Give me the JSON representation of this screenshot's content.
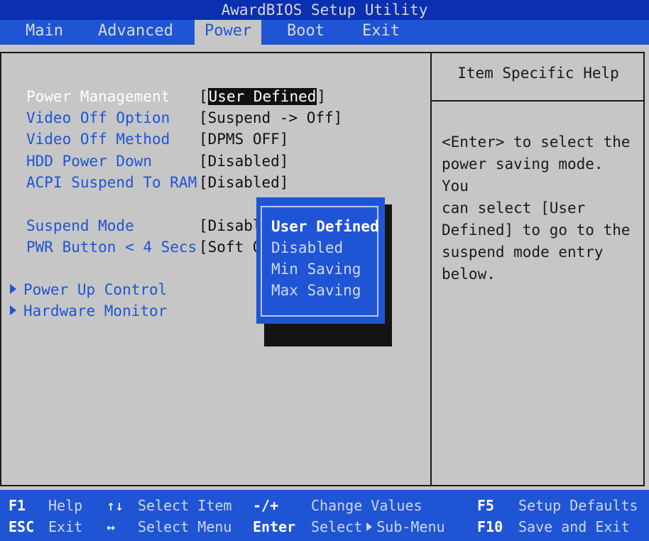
{
  "window": {
    "title": "AwardBIOS Setup Utility"
  },
  "menu": {
    "tabs": [
      {
        "label": "Main"
      },
      {
        "label": "Advanced"
      },
      {
        "label": "Power"
      },
      {
        "label": "Boot"
      },
      {
        "label": "Exit"
      }
    ],
    "active": "Power"
  },
  "options": [
    {
      "label": "Power Management",
      "value": "[",
      "value_highlight": "User Defined",
      "value_end": "]"
    },
    {
      "label": "Video Off Option",
      "value": "[Suspend -> Off]"
    },
    {
      "label": "Video Off Method",
      "value": "[DPMS OFF]"
    },
    {
      "label": "HDD Power Down",
      "value": "[Disabled]"
    },
    {
      "label": "ACPI Suspend To RAM",
      "value": "[Disabled]"
    },
    {
      "label": "Suspend Mode",
      "value": "[Disabl"
    },
    {
      "label": "PWR Button < 4 Secs",
      "value": "[Soft O"
    }
  ],
  "submenus": [
    {
      "label": "Power Up Control",
      "icon": "triangle-right-icon"
    },
    {
      "label": "Hardware Monitor",
      "icon": "triangle-right-icon"
    }
  ],
  "popup": {
    "items": [
      "User Defined",
      "Disabled",
      "Min Saving",
      "Max Saving"
    ],
    "selected": "User Defined"
  },
  "help": {
    "title": "Item Specific Help",
    "text": "<Enter> to select the\npower saving mode. You\ncan select [User\nDefined] to go to the\nsuspend mode entry\nbelow."
  },
  "footer": {
    "f1_key": "F1",
    "f1_desc": "Help",
    "esc_key": "ESC",
    "esc_desc": "Exit",
    "updown_symbol": "↑↓",
    "updown_desc": "Select Item",
    "leftright_symbol": "↔",
    "leftright_desc": "Select Menu",
    "plusminus_key": "-/+",
    "plusminus_desc": "Change Values",
    "enter_key": "Enter",
    "enter_desc_a": "Select",
    "enter_desc_b": "Sub-Menu",
    "f5_key": "F5",
    "f5_desc": "Setup Defaults",
    "f10_key": "F10",
    "f10_desc": "Save and Exit"
  },
  "colors": {
    "menu_bar": "#1f55d4",
    "title_bar": "#0a2fb0",
    "background": "#c6c6c6",
    "label_blue": "#1f55d4"
  }
}
